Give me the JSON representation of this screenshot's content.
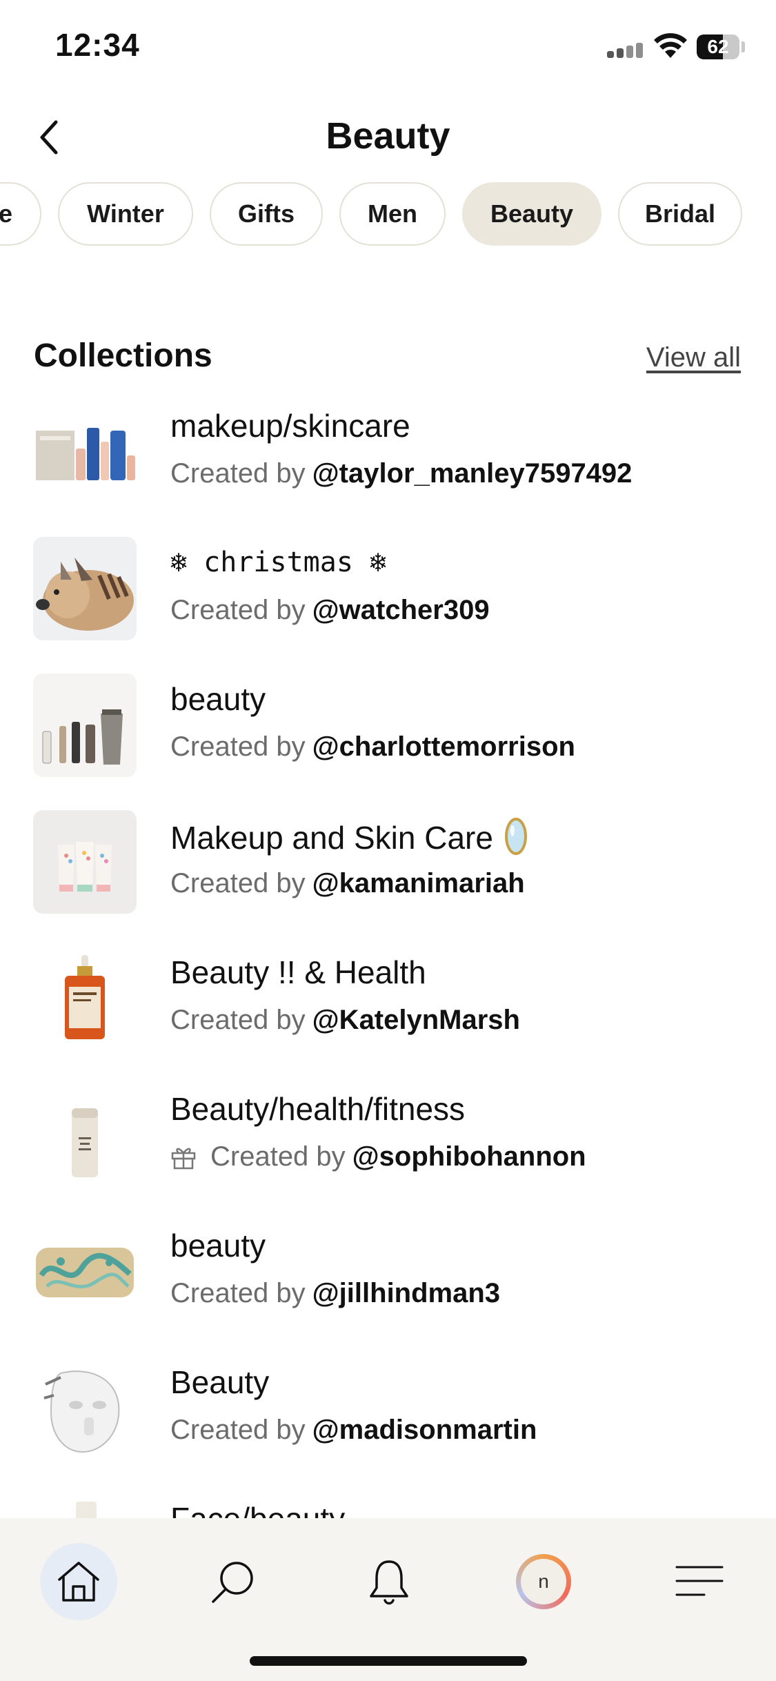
{
  "status": {
    "time": "12:34",
    "battery": "62",
    "battery_level": 0.62
  },
  "header": {
    "title": "Beauty"
  },
  "chips": [
    {
      "label": "e",
      "active": false
    },
    {
      "label": "Winter",
      "active": false
    },
    {
      "label": "Gifts",
      "active": false
    },
    {
      "label": "Men",
      "active": false
    },
    {
      "label": "Beauty",
      "active": true
    },
    {
      "label": "Bridal",
      "active": false
    }
  ],
  "collections": {
    "title": "Collections",
    "view_all": "View all",
    "created_by": "Created by",
    "items": [
      {
        "title": "makeup/skincare",
        "handle": "@taylor_manley7597492"
      },
      {
        "title": "❄ christmas ❄",
        "handle": "@watcher309"
      },
      {
        "title": "beauty",
        "handle": "@charlottemorrison"
      },
      {
        "title": "Makeup and Skin Care",
        "handle": "@kamanimariah"
      },
      {
        "title": "Beauty !! & Health",
        "handle": "@KatelynMarsh"
      },
      {
        "title": "Beauty/health/fitness",
        "handle": "@sophibohannon"
      },
      {
        "title": "beauty",
        "handle": "@jillhindman3"
      },
      {
        "title": "Beauty",
        "handle": "@madisonmartin"
      },
      {
        "title": "Face/beauty",
        "handle": ""
      }
    ]
  },
  "nav": {
    "avatar_initial": "n"
  }
}
